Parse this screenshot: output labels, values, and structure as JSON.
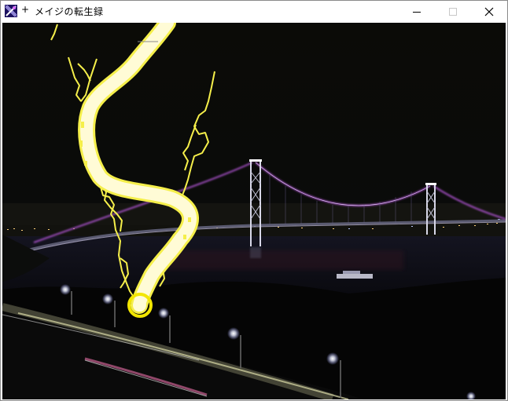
{
  "window": {
    "title_marker": "+",
    "title": "メイジの転生録",
    "controls": {
      "minimize_icon": "minimize-icon",
      "maximize_icon": "maximize-icon",
      "close_icon": "close-icon"
    }
  },
  "scene": {
    "description_icon": "night-bridge-scene",
    "colors": {
      "sky": "#0a0a06",
      "lightning_core": "#fffbd6",
      "lightning_edge": "#f5ef4a",
      "impact_ring": "#f2e600",
      "cable_glow": "#a04ec0",
      "city_lights": "#ffd27a"
    }
  }
}
